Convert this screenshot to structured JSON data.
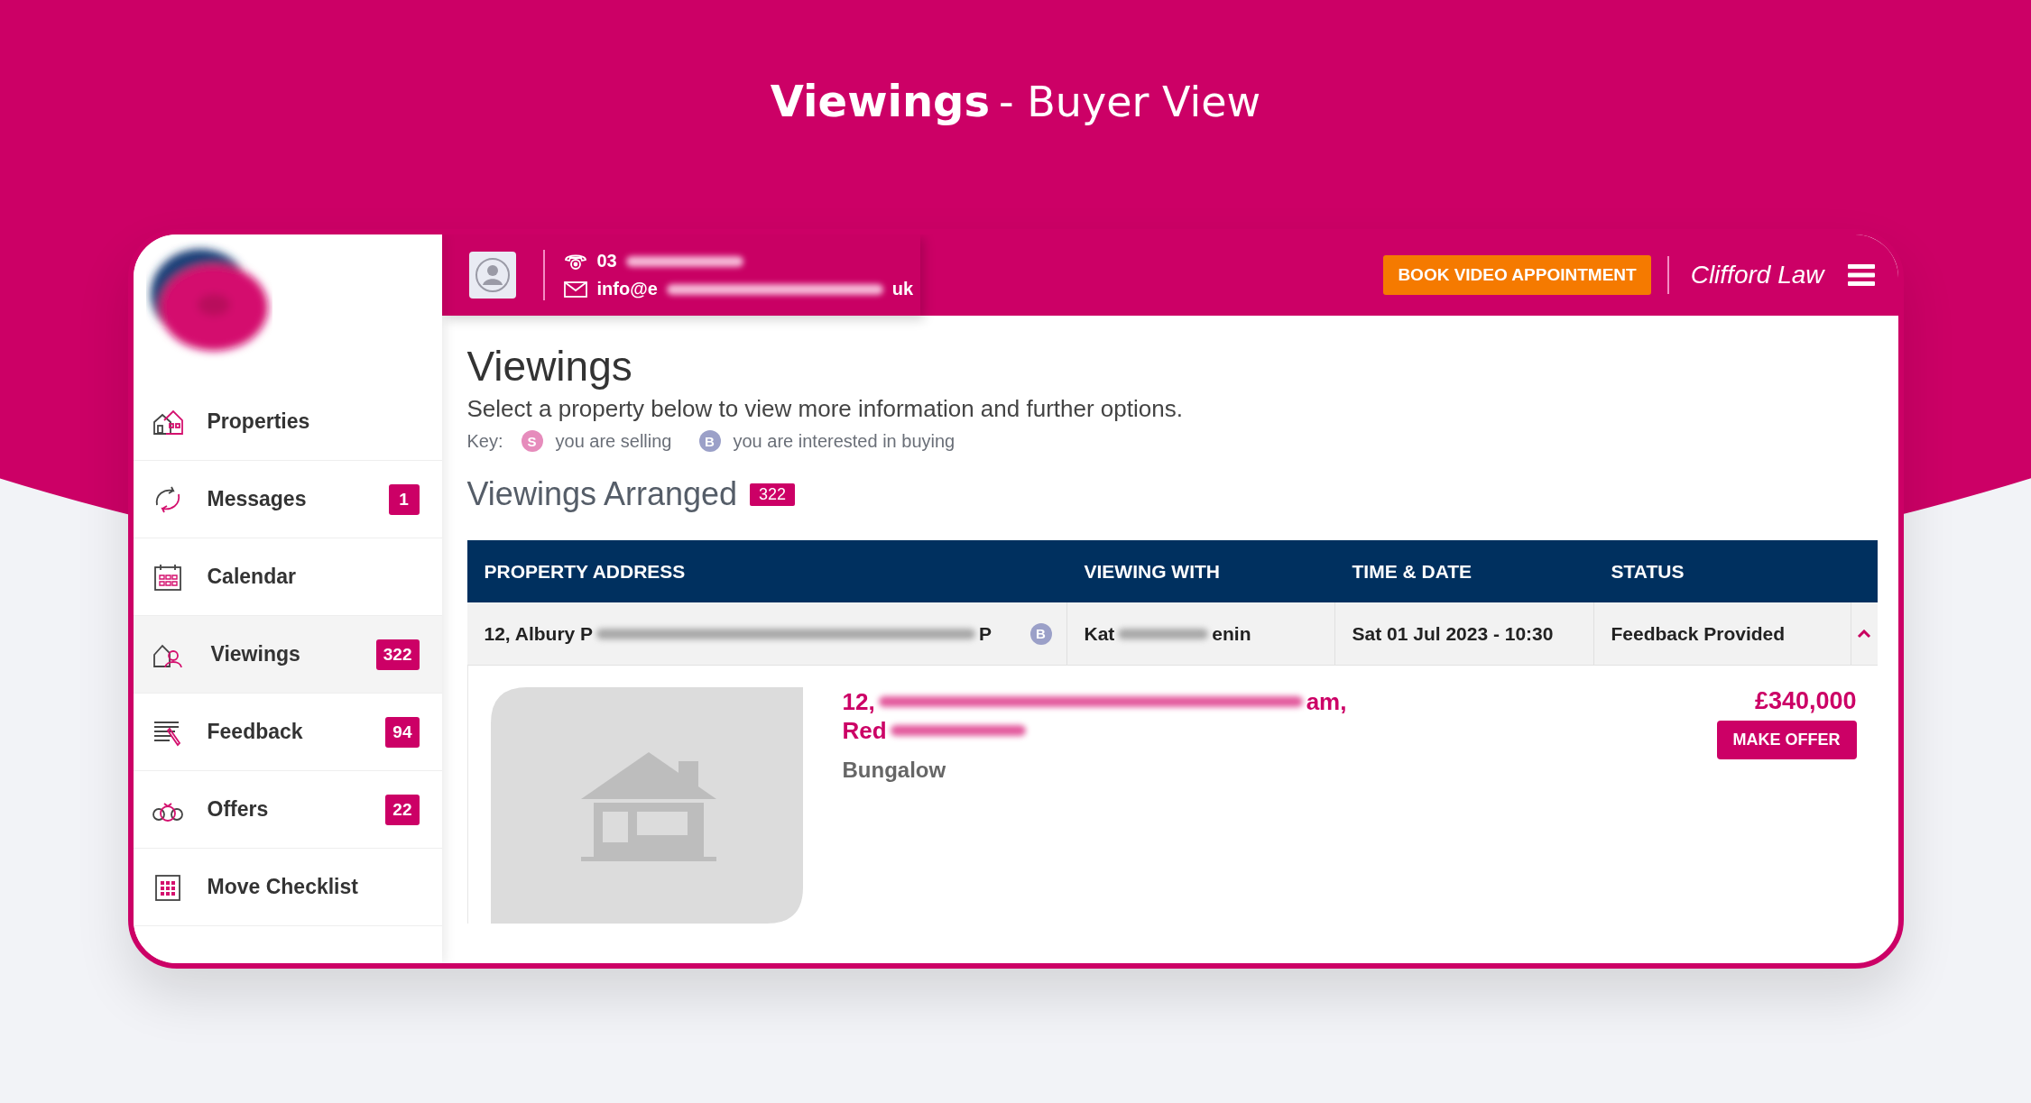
{
  "page_title": {
    "main": "Viewings",
    "sub": "- Buyer View"
  },
  "sidebar": {
    "items": [
      {
        "label": "Properties",
        "selected": false
      },
      {
        "label": "Messages",
        "badge": "1",
        "selected": false
      },
      {
        "label": "Calendar",
        "selected": false
      },
      {
        "label": "Viewings",
        "badge": "322",
        "selected": true
      },
      {
        "label": "Feedback",
        "badge": "94",
        "selected": false
      },
      {
        "label": "Offers",
        "badge": "22",
        "selected": false
      },
      {
        "label": "Move Checklist",
        "selected": false
      }
    ]
  },
  "topbar": {
    "phone": "03",
    "email_start": "info@e",
    "email_end": "uk",
    "book_button": "BOOK VIDEO APPOINTMENT",
    "firm": "Clifford Law"
  },
  "page": {
    "heading": "Viewings",
    "intro": "Select a property below to view more information and further options.",
    "key_label": "Key:",
    "key": [
      {
        "letter": "S",
        "text": "you are selling",
        "color": "#e68cbc"
      },
      {
        "letter": "B",
        "text": "you are interested in buying",
        "color": "#9ba0c8"
      }
    ],
    "section_title": "Viewings Arranged",
    "section_count": "322"
  },
  "table": {
    "columns": [
      "PROPERTY ADDRESS",
      "VIEWING WITH",
      "TIME & DATE",
      "STATUS"
    ],
    "rows": [
      {
        "address_start": "12, Albury P",
        "address_end": "P",
        "role": {
          "letter": "B",
          "color": "#9ba0c8"
        },
        "viewing_with_start": "Kat",
        "viewing_with_end": "enin",
        "time_date": "Sat 01 Jul 2023 - 10:30",
        "status": "Feedback Provided",
        "expanded": true
      }
    ]
  },
  "detail": {
    "address_line1_start": "12,",
    "address_line1_end": "am,",
    "address_line2_start": "Red",
    "property_type": "Bungalow",
    "price": "£340,000",
    "offer_button": "MAKE OFFER"
  }
}
